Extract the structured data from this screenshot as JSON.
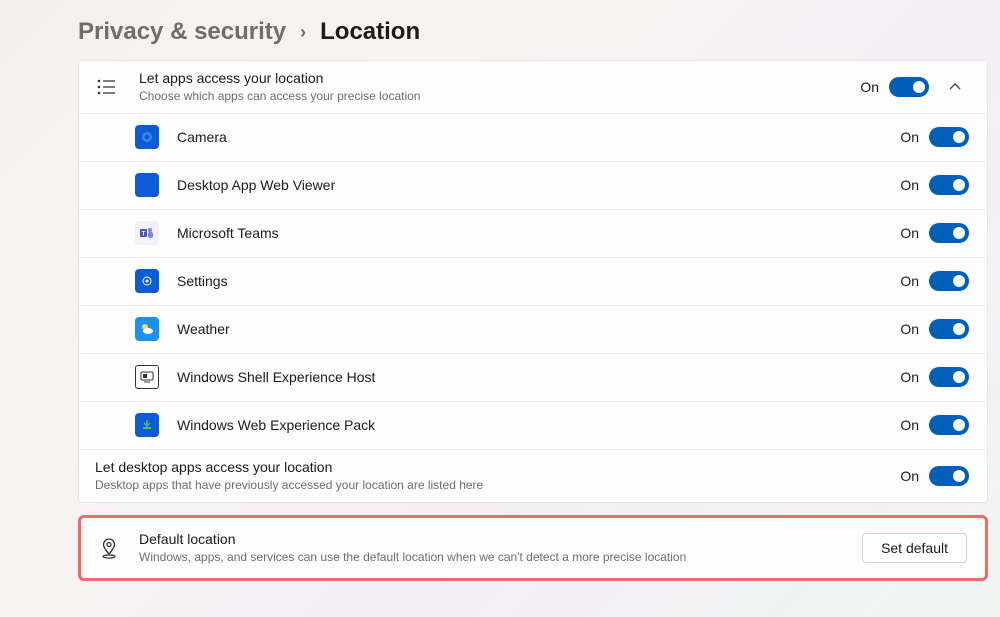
{
  "breadcrumb": {
    "parent": "Privacy & security",
    "separator": "›",
    "current": "Location"
  },
  "main_toggle": {
    "title": "Let apps access your location",
    "subtitle": "Choose which apps can access your precise location",
    "status": "On"
  },
  "apps": [
    {
      "name": "Camera",
      "status": "On"
    },
    {
      "name": "Desktop App Web Viewer",
      "status": "On"
    },
    {
      "name": "Microsoft Teams",
      "status": "On"
    },
    {
      "name": "Settings",
      "status": "On"
    },
    {
      "name": "Weather",
      "status": "On"
    },
    {
      "name": "Windows Shell Experience Host",
      "status": "On"
    },
    {
      "name": "Windows Web Experience Pack",
      "status": "On"
    }
  ],
  "desktop_apps": {
    "title": "Let desktop apps access your location",
    "subtitle": "Desktop apps that have previously accessed your location are listed here",
    "status": "On"
  },
  "default_location": {
    "title": "Default location",
    "subtitle": "Windows, apps, and services can use the default location when we can't detect a more precise location",
    "button": "Set default"
  }
}
